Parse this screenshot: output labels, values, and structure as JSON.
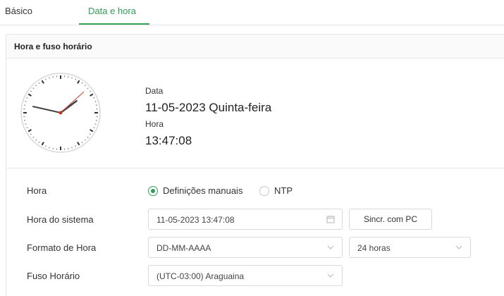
{
  "tabs": [
    {
      "label": "Básico",
      "active": false
    },
    {
      "label": "Data e hora",
      "active": true
    }
  ],
  "accent_color": "#2e9c55",
  "panel": {
    "title": "Hora e fuso horário",
    "clock": {
      "hour": 13,
      "minute": 47,
      "second": 8
    },
    "date_label": "Data",
    "date_value": "11-05-2023 Quinta-feira",
    "time_label": "Hora",
    "time_value": "13:47:08"
  },
  "form": {
    "time_mode": {
      "label": "Hora",
      "options": [
        {
          "label": "Definições manuais",
          "selected": true
        },
        {
          "label": "NTP",
          "selected": false
        }
      ]
    },
    "system_time": {
      "label": "Hora do sistema",
      "value": "11-05-2023 13:47:08",
      "icon": "calendar-icon",
      "sync_button": "Sincr. com PC"
    },
    "time_format": {
      "label": "Formato de Hora",
      "date_format": "DD-MM-AAAA",
      "hour_format": "24 horas"
    },
    "timezone": {
      "label": "Fuso Horário",
      "value": "(UTC-03:00) Araguaina"
    }
  }
}
